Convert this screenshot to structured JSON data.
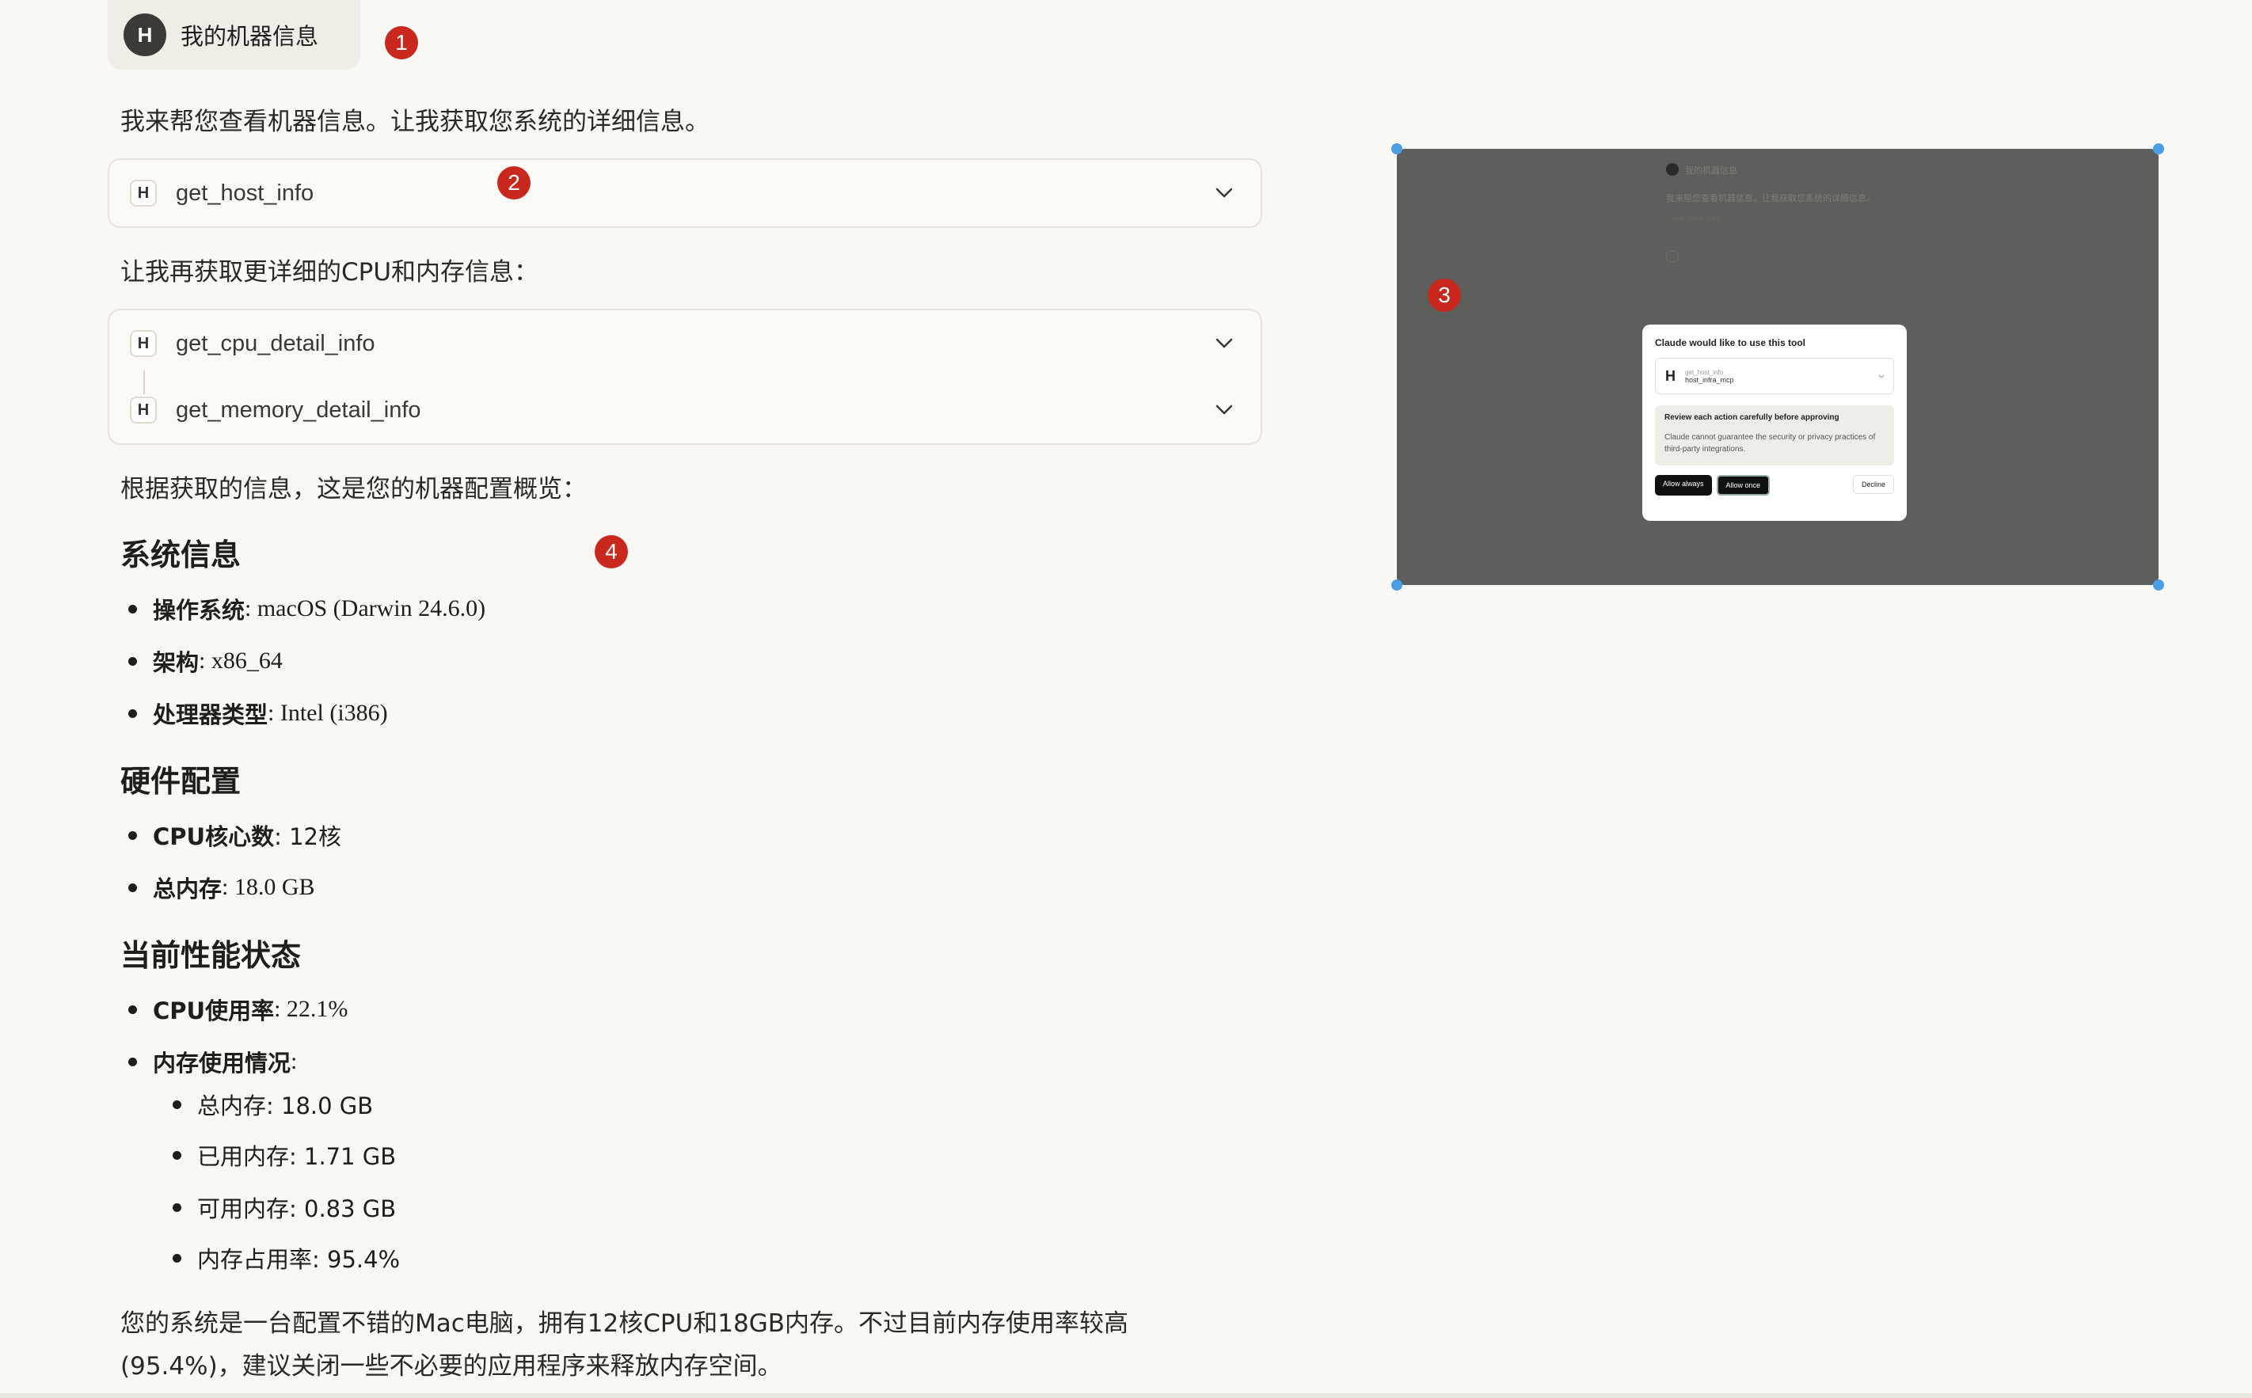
{
  "user_message": {
    "avatar_initial": "H",
    "text": "我的机器信息"
  },
  "badges": [
    "1",
    "2",
    "3",
    "4"
  ],
  "intro": "我来帮您查看机器信息。让我获取您系统的详细信息。",
  "tool_calls_1": [
    {
      "icon": "H",
      "name": "get_host_info"
    }
  ],
  "mid_text": "让我再获取更详细的CPU和内存信息：",
  "tool_calls_2": [
    {
      "icon": "H",
      "name": "get_cpu_detail_info"
    },
    {
      "icon": "H",
      "name": "get_memory_detail_info"
    }
  ],
  "overview_text": "根据获取的信息，这是您的机器配置概览：",
  "sections": {
    "system": {
      "title": "系统信息",
      "items": [
        {
          "label": "操作系统",
          "value": ": macOS (Darwin 24.6.0)"
        },
        {
          "label": "架构",
          "value": ": x86_64"
        },
        {
          "label": "处理器类型",
          "value": ": Intel (i386)"
        }
      ]
    },
    "hardware": {
      "title": "硬件配置",
      "items": [
        {
          "label": "CPU核心数",
          "value": ": 12核"
        },
        {
          "label": "总内存",
          "value": ": 18.0 GB"
        }
      ]
    },
    "performance": {
      "title": "当前性能状态",
      "items": [
        {
          "label": "CPU使用率",
          "value": ": 22.1%"
        },
        {
          "label": "内存使用情况",
          "value": ":"
        }
      ],
      "memory_sub": [
        "总内存: 18.0 GB",
        "已用内存: 1.71 GB",
        "可用内存: 0.83 GB",
        "内存占用率: 95.4%"
      ]
    }
  },
  "summary": "您的系统是一台配置不错的Mac电脑，拥有12核CPU和18GB内存。不过目前内存使用率较高(95.4%)，建议关闭一些不必要的应用程序来释放内存空间。",
  "thumbnail": {
    "bg_user_text": "我的机器信息",
    "bg_intro": "我来帮您查看机器信息。让我获取您系统的详细信息。",
    "bg_tool": "get_host_info",
    "modal": {
      "title": "Claude would like to use this tool",
      "tool_icon": "H",
      "tool_name": "get_host_info",
      "server": "host_infra_mcp",
      "warning_title": "Review each action carefully before approving",
      "warning_text": "Claude cannot guarantee the security or privacy practices of third-party integrations.",
      "allow_always": "Allow always",
      "allow_once": "Allow once",
      "decline": "Decline"
    }
  },
  "colors": {
    "badge": "#c8281e",
    "handle": "#4a9ee6",
    "background": "#f9f8f5"
  }
}
